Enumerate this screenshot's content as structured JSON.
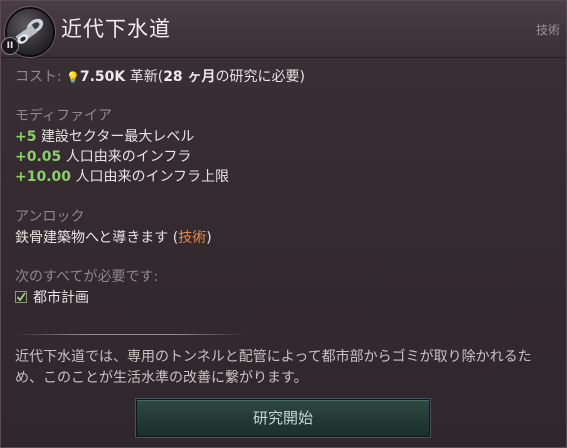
{
  "header": {
    "title": "近代下水道",
    "category": "技術",
    "pause_badge": "II"
  },
  "cost": {
    "label": "コスト:",
    "amount": "7.50K",
    "resource": "革新(",
    "months": "28 ヶ月",
    "suffix": "の研究に必要)"
  },
  "modifiers": {
    "heading": "モディファイア",
    "items": [
      {
        "value": "+5",
        "text": "建設セクター最大レベル"
      },
      {
        "value": "+0.05",
        "text": "人口由来のインフラ"
      },
      {
        "value": "+10.00",
        "text": "人口由来のインフラ上限"
      }
    ]
  },
  "unlocks": {
    "heading": "アンロック",
    "text_before": "鉄骨建築物へと導きます (",
    "link": "技術",
    "text_after": ")"
  },
  "requirements": {
    "heading": "次のすべてが必要です:",
    "items": [
      {
        "text": "都市計画",
        "met": true
      }
    ]
  },
  "description": "近代下水道では、専用のトンネルと配管によって都市部からゴミが取り除かれるため、このことが生活水準の改善に繋がります。",
  "button": {
    "label": "研究開始"
  },
  "colors": {
    "positive": "#8ccf6a",
    "link": "#e08a4a",
    "button": "#2f4a43"
  }
}
